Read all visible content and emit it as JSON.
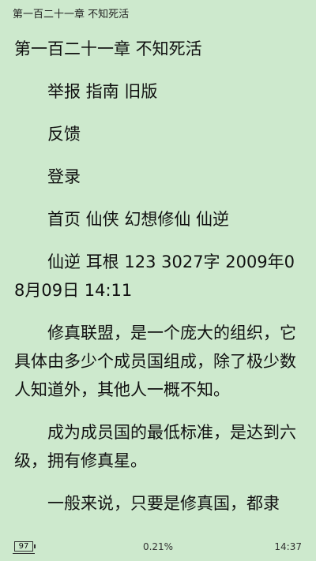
{
  "header": {
    "title": "第一百二十一章 不知死活"
  },
  "content": {
    "chapter_title": "第一百二十一章 不知死活",
    "paragraphs": [
      "举报 指南 旧版",
      "反馈",
      "登录",
      "首页 仙侠 幻想修仙 仙逆",
      "仙逆 耳根 123 3027字 2009年08月09日 14:11",
      "修真联盟，是一个庞大的组织，它具体由多少个成员国组成，除了极少数人知道外，其他人一概不知。",
      "成为成员国的最低标准，是达到六级，拥有修真星。",
      "一般来说，只要是修真国，都隶"
    ]
  },
  "footer": {
    "battery": "97",
    "progress": "0.21%",
    "time": "14:37"
  },
  "colors": {
    "background": "#cde9cd",
    "text": "#111111"
  }
}
